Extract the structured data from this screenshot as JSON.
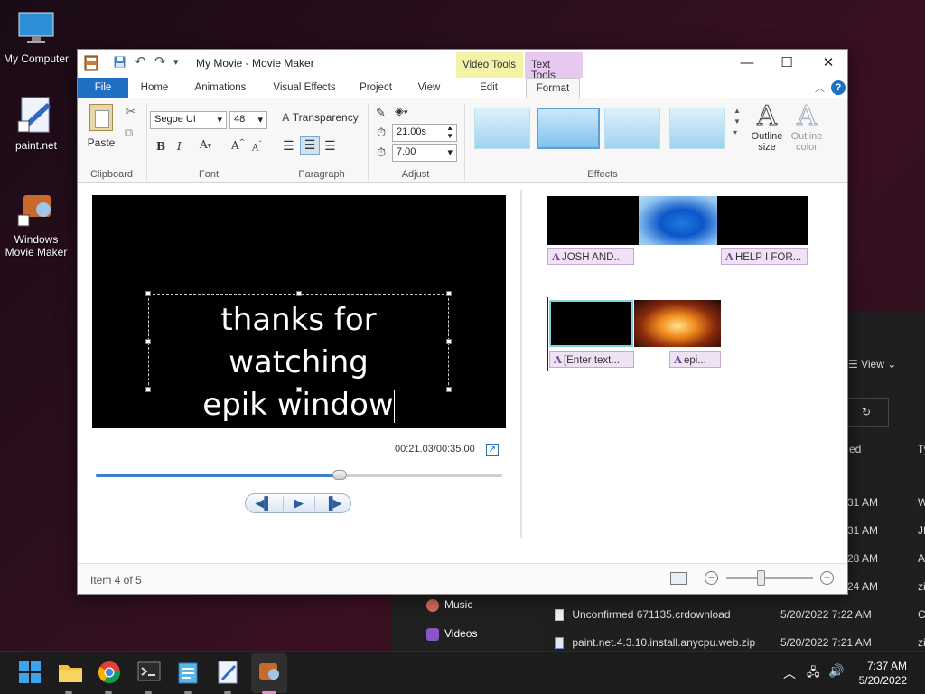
{
  "desktop": {
    "icons": [
      {
        "label": "My Computer"
      },
      {
        "label": "paint.net"
      },
      {
        "label": "Windows Movie Maker"
      }
    ]
  },
  "explorer": {
    "view_label": "View",
    "col_modified": "ed",
    "col_type": "Ty",
    "rows": [
      {
        "time": "31 AM",
        "type": "W"
      },
      {
        "time": "31 AM",
        "type": "JP"
      },
      {
        "time": "28 AM",
        "type": "A"
      },
      {
        "time": "24 AM",
        "type": "zi"
      },
      {
        "name": "Unconfirmed 671135.crdownload",
        "date": "5/20/2022 7:22 AM",
        "type": "C"
      },
      {
        "name": "paint.net.4.3.10.install.anycpu.web.zip",
        "date": "5/20/2022 7:21 AM",
        "type": "zi"
      }
    ],
    "sidebar": [
      {
        "label": "Music"
      },
      {
        "label": "Videos"
      }
    ]
  },
  "window": {
    "title": "My Movie - Movie Maker",
    "context_tabs": {
      "video_tools": "Video Tools",
      "text_tools": "Text Tools"
    },
    "tabs": [
      "File",
      "Home",
      "Animations",
      "Visual Effects",
      "Project",
      "View",
      "Edit",
      "Format"
    ],
    "ribbon": {
      "paste_label": "Paste",
      "clipboard_label": "Clipboard",
      "font_name": "Segoe UI",
      "font_size": "48",
      "font_label": "Font",
      "transparency_label": "Transparency",
      "paragraph_label": "Paragraph",
      "start_time": "21.00s",
      "duration": "7.00",
      "adjust_label": "Adjust",
      "effects_label": "Effects",
      "outline_size_label": "Outline size",
      "outline_color_label": "Outline color"
    },
    "preview": {
      "caption_line1": "thanks for watching",
      "caption_line2": "epik window",
      "time": "00:21.03/00:35.00",
      "seek_progress": 0.6
    },
    "storyboard": {
      "captions": [
        "JOSH AND...",
        "HELP I FOR...",
        "[Enter text...",
        "epi..."
      ]
    },
    "status": "Item 4 of 5"
  },
  "taskbar": {
    "time": "7:37 AM",
    "date": "5/20/2022"
  }
}
